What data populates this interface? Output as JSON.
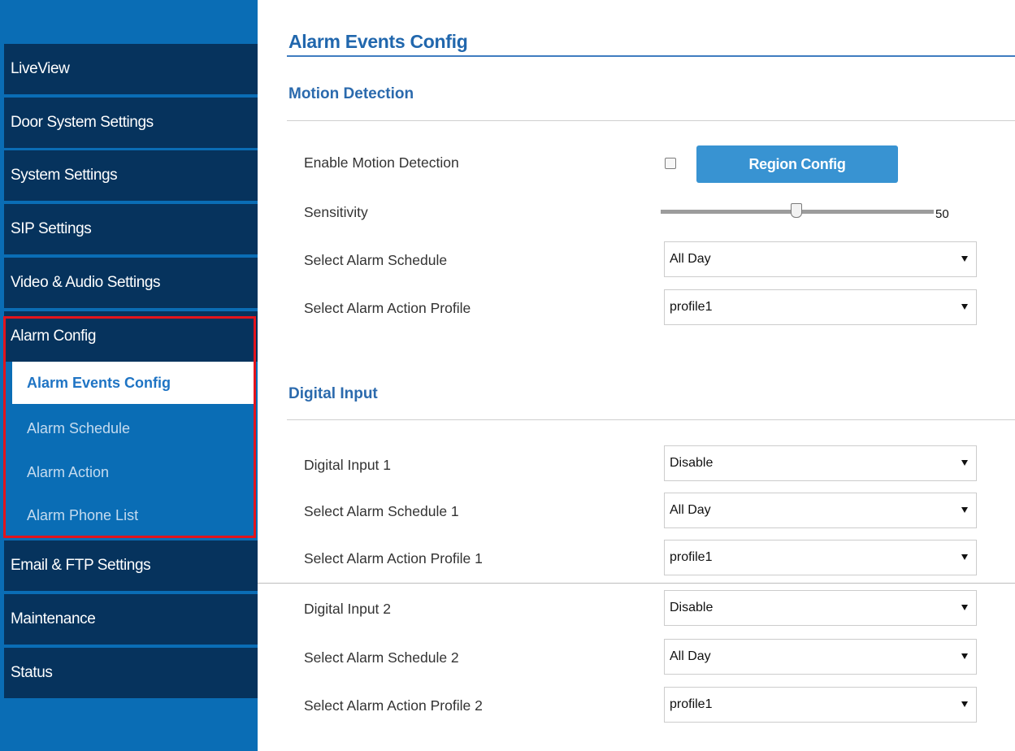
{
  "sidebar": {
    "items": [
      {
        "label": "LiveView"
      },
      {
        "label": "Door System Settings"
      },
      {
        "label": "System Settings"
      },
      {
        "label": "SIP Settings"
      },
      {
        "label": "Video & Audio Settings"
      },
      {
        "label": "Alarm Config",
        "expanded": true,
        "subitems": [
          {
            "label": "Alarm Events Config",
            "active": true
          },
          {
            "label": "Alarm Schedule"
          },
          {
            "label": "Alarm Action"
          },
          {
            "label": "Alarm Phone List"
          }
        ]
      },
      {
        "label": "Email & FTP Settings"
      },
      {
        "label": "Maintenance"
      },
      {
        "label": "Status"
      }
    ],
    "highlight_color": "#e3141c"
  },
  "main": {
    "title": "Alarm Events Config",
    "motion_detection": {
      "heading": "Motion Detection",
      "enable_label": "Enable Motion Detection",
      "enabled": false,
      "region_button": "Region Config",
      "sensitivity_label": "Sensitivity",
      "sensitivity_value": "50",
      "schedule_label": "Select Alarm Schedule",
      "schedule_value": "All Day",
      "profile_label": "Select Alarm Action Profile",
      "profile_value": "profile1"
    },
    "digital_input": {
      "heading": "Digital Input",
      "inputs": [
        {
          "label": "Digital Input 1",
          "value": "Disable",
          "schedule_label": "Select Alarm Schedule 1",
          "schedule_value": "All Day",
          "profile_label": "Select Alarm Action Profile 1",
          "profile_value": "profile1"
        },
        {
          "label": "Digital Input 2",
          "value": "Disable",
          "schedule_label": "Select Alarm Schedule 2",
          "schedule_value": "All Day",
          "profile_label": "Select Alarm Action Profile 2",
          "profile_value": "profile1"
        }
      ]
    }
  },
  "colors": {
    "sidebar_bg": "#0a6db5",
    "nav_item_bg": "#06335d",
    "accent": "#2167ad",
    "button_bg": "#3893d2"
  }
}
